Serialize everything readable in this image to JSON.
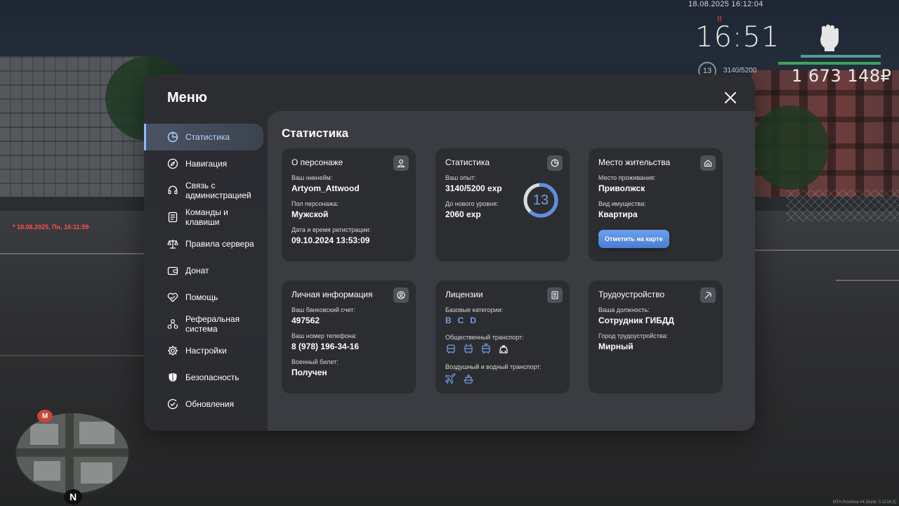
{
  "hud": {
    "datetime": "18.08.2025 16:12:04",
    "time": "16:51",
    "time_marker": "!!",
    "level": "13",
    "exp": "3140/5200",
    "money": "1 673 148₽",
    "red_date": "* 18.08.2025, Пн, 16:11:59",
    "build": "MTA Province #4 (build: 0.1216.5)",
    "minimap_marker": "М",
    "minimap_north": "N",
    "colors": {
      "bar_top": "#4f9c92",
      "bar_bottom": "#3fa35a"
    }
  },
  "menu": {
    "title": "Меню",
    "close_icon": "close-icon"
  },
  "sidebar": {
    "items": [
      {
        "label": "Статистика",
        "icon": "pie-chart-icon",
        "active": true
      },
      {
        "label": "Навигация",
        "icon": "compass-icon"
      },
      {
        "label": "Связь с администрацией",
        "icon": "headset-icon"
      },
      {
        "label": "Команды и клавиши",
        "icon": "keyboard-list-icon"
      },
      {
        "label": "Правила сервера",
        "icon": "scales-icon"
      },
      {
        "label": "Донат",
        "icon": "wallet-icon"
      },
      {
        "label": "Помощь",
        "icon": "heart-handshake-icon"
      },
      {
        "label": "Реферальная система",
        "icon": "network-icon"
      },
      {
        "label": "Настройки",
        "icon": "gear-icon"
      },
      {
        "label": "Безопасность",
        "icon": "shield-icon"
      },
      {
        "label": "Обновления",
        "icon": "check-circle-icon"
      }
    ]
  },
  "content": {
    "title": "Статистика",
    "character": {
      "title": "О персонаже",
      "nickname_label": "Ваш никнейм:",
      "nickname": "Artyom_Attwood",
      "gender_label": "Пол персонажа:",
      "gender": "Мужской",
      "reg_label": "Дата и время регистрации:",
      "reg": "09.10.2024 13:53:09"
    },
    "stats": {
      "title": "Статистика",
      "exp_label": "Ваш опыт:",
      "exp": "3140/5200 exp",
      "next_label": "До нового уровня:",
      "next": "2060 exp",
      "level": "13",
      "progress": 0.604
    },
    "residence": {
      "title": "Место жительства",
      "place_label": "Место проживания:",
      "place": "Приволжск",
      "property_label": "Вид имущества:",
      "property": "Квартира",
      "map_button": "Отметить на карте"
    },
    "personal": {
      "title": "Личная информация",
      "bank_label": "Ваш банковский счет:",
      "bank": "497562",
      "phone_label": "Ваш номер телефона:",
      "phone": "8 (978) 196-34-16",
      "military_label": "Военный билет:",
      "military": "Получен"
    },
    "licenses": {
      "title": "Лицензии",
      "basic_label": "Базовые категории:",
      "categories": [
        "B",
        "C",
        "D"
      ],
      "public_label": "Общественный транспорт:",
      "public_icons": [
        "bus-icon",
        "trolleybus-icon",
        "tram-icon",
        "taxi-icon"
      ],
      "air_label": "Воздушный и водный транспорт:",
      "air_icons": [
        "plane-icon",
        "ship-icon"
      ]
    },
    "employment": {
      "title": "Трудоустройство",
      "position_label": "Ваша должность:",
      "position": "Сотрудник ГИБДД",
      "city_label": "Город трудоустройства:",
      "city": "Мирный"
    }
  }
}
